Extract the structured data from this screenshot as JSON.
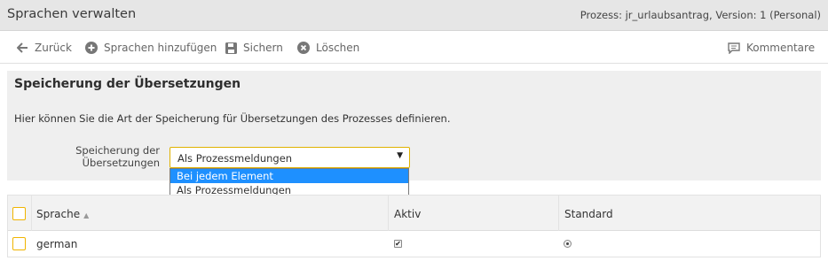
{
  "titlebar": {
    "title": "Sprachen verwalten",
    "meta": "Prozess: jr_urlaubsantrag, Version: 1 (Personal)"
  },
  "toolbar": {
    "back": "Zurück",
    "add": "Sprachen hinzufügen",
    "save": "Sichern",
    "delete": "Löschen",
    "comments": "Kommentare"
  },
  "panel": {
    "heading": "Speicherung der Übersetzungen",
    "description": "Hier können Sie die Art der Speicherung für Übersetzungen des Prozesses definieren.",
    "field_label_line1": "Speicherung der",
    "field_label_line2": "Übersetzungen",
    "select_value": "Als Prozessmeldungen",
    "options": [
      "Bei jedem Element",
      "Als Prozessmeldungen"
    ],
    "highlighted_option": 0
  },
  "grid": {
    "columns": {
      "language": "Sprache",
      "active": "Aktiv",
      "default": "Standard"
    },
    "rows": [
      {
        "language": "german",
        "active": true,
        "default": true
      }
    ]
  },
  "colors": {
    "accent": "#f0b400",
    "selection": "#1e90ff",
    "header_bg": "#e6e6e6"
  }
}
